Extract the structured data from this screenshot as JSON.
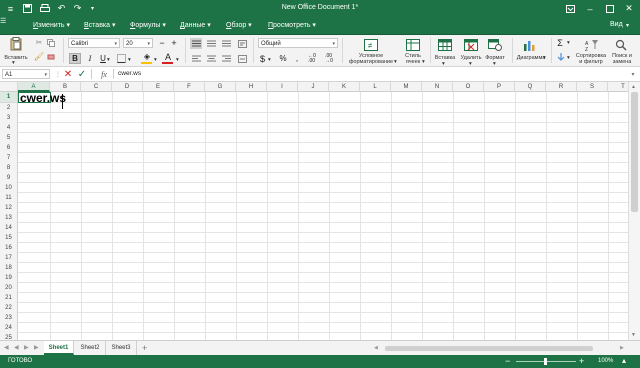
{
  "window": {
    "title": "New Office Document 1*",
    "view_label": "Вид"
  },
  "menu": {
    "items": [
      {
        "prefix": "И",
        "rest": "зменить"
      },
      {
        "prefix": "В",
        "rest": "ставка"
      },
      {
        "prefix": "Ф",
        "rest": "ормулы"
      },
      {
        "prefix": "Д",
        "rest": "анные"
      },
      {
        "prefix": "О",
        "rest": "бзор"
      },
      {
        "prefix": "П",
        "rest": "росмотреть"
      }
    ]
  },
  "ribbon": {
    "paste_label": "Вставить",
    "font_name": "Calibri",
    "font_size": "20",
    "number_format": "Общий",
    "cond_format_label_1": "Условное",
    "cond_format_label_2": "форматирование",
    "cell_style_label_1": "Стиль",
    "cell_style_label_2": "ячеек",
    "insert_label": "Вставка",
    "delete_label": "Удалить",
    "format_label": "Формат",
    "chart_label": "Диаграмма",
    "sort_label_1": "Сортировка",
    "sort_label_2": "и фильтр",
    "find_label_1": "Поиск и",
    "find_label_2": "замена",
    "accent_color": "#1e7346",
    "fill_color": "#ffc000",
    "font_color": "#d92020"
  },
  "formula_bar": {
    "cell_ref": "A1",
    "fx": "fx",
    "content": "cwer.ws"
  },
  "grid": {
    "columns": [
      "A",
      "B",
      "C",
      "D",
      "E",
      "F",
      "G",
      "H",
      "I",
      "J",
      "K",
      "L",
      "M",
      "N",
      "O",
      "P",
      "Q",
      "R",
      "S",
      "T"
    ],
    "rows": [
      "1",
      "2",
      "3",
      "4",
      "5",
      "6",
      "7",
      "8",
      "9",
      "10",
      "11",
      "12",
      "13",
      "14",
      "15",
      "16",
      "17",
      "18",
      "19",
      "20",
      "21",
      "22",
      "23",
      "24",
      "25"
    ],
    "cell_a1": "cwer.ws"
  },
  "sheets": {
    "tabs": [
      "Sheet1",
      "Sheet2",
      "Sheet3"
    ],
    "add": "+"
  },
  "status": {
    "ready": "ГОТОВО",
    "zoom": "100%",
    "zoom_minus": "−",
    "zoom_plus": "+"
  }
}
